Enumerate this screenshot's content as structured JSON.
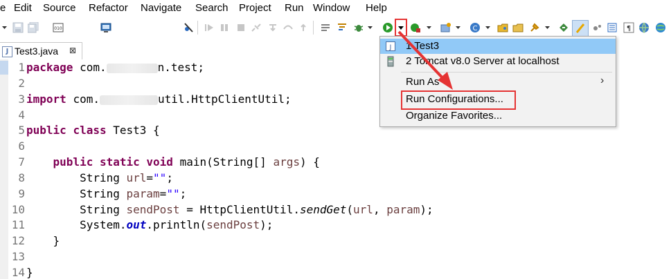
{
  "menu": [
    "e",
    "Edit",
    "Source",
    "Refactor",
    "Navigate",
    "Search",
    "Project",
    "Run",
    "Window",
    "Help"
  ],
  "toolbar": {
    "icons": [
      "new-dropdown",
      "save",
      "save-all",
      "binary",
      "console",
      "skip-breakpoints",
      "resume",
      "suspend",
      "terminate",
      "disconnect",
      "step-into",
      "step-over",
      "step-return",
      "drop-to-frame",
      "use-step-filters",
      "open-task",
      "debug",
      "run",
      "run-dropdown",
      "coverage",
      "external-tools",
      "new-java-project",
      "new-class",
      "open-type",
      "open-task-2",
      "search",
      "annotation",
      "highlight",
      "toggle-mark",
      "show-whitespace",
      "web-browser",
      "globe"
    ],
    "accent_run": "#2a9a2a",
    "highlight_color": "#e53333"
  },
  "editor_tab": {
    "label": "Test3.java",
    "close": "⊠",
    "icon": "J"
  },
  "code": {
    "lines": [
      {
        "n": "1"
      },
      {
        "n": "2"
      },
      {
        "n": "3"
      },
      {
        "n": "4"
      },
      {
        "n": "5"
      },
      {
        "n": "6"
      },
      {
        "n": "7"
      },
      {
        "n": "8"
      },
      {
        "n": "9"
      },
      {
        "n": "10"
      },
      {
        "n": "11"
      },
      {
        "n": "12"
      },
      {
        "n": "13"
      },
      {
        "n": "14"
      }
    ],
    "t": {
      "package_kw": "package",
      "package_pre": "com.",
      "package_post": "n.test;",
      "import_kw": "import",
      "import_pre": "com.",
      "import_post": "util.HttpClientUtil;",
      "public_kw": "public",
      "class_kw": "class",
      "class_name": "Test3 {",
      "static_kw": "static",
      "void_kw": "void",
      "main_sig": "main(String[] ",
      "args": "args",
      "main_end": ") {",
      "string_type": "String ",
      "url": "url",
      "param": "param",
      "send_post": "sendPost",
      "eq_str": "=",
      "empty_str": "\"\"",
      "semi": ";",
      "assign": " = HttpClientUtil.",
      "send_get": "sendGet",
      "paren_open": "(",
      "comma": ", ",
      "close_call": ");",
      "system": "System.",
      "out": "out",
      "println": ".println(",
      "close_brace": "}"
    }
  },
  "dropdown": {
    "items": [
      {
        "label": "1 Test3",
        "icon": "java-app-icon",
        "selected": true
      },
      {
        "label": "2 Tomcat v8.0 Server at localhost",
        "icon": "tomcat-server-icon"
      },
      {
        "label": "Run As",
        "submenu": "›"
      },
      {
        "label": "Run Configurations...",
        "highlighted": true
      },
      {
        "label": "Organize Favorites..."
      }
    ]
  },
  "annotation": {
    "color": "#e53333"
  }
}
